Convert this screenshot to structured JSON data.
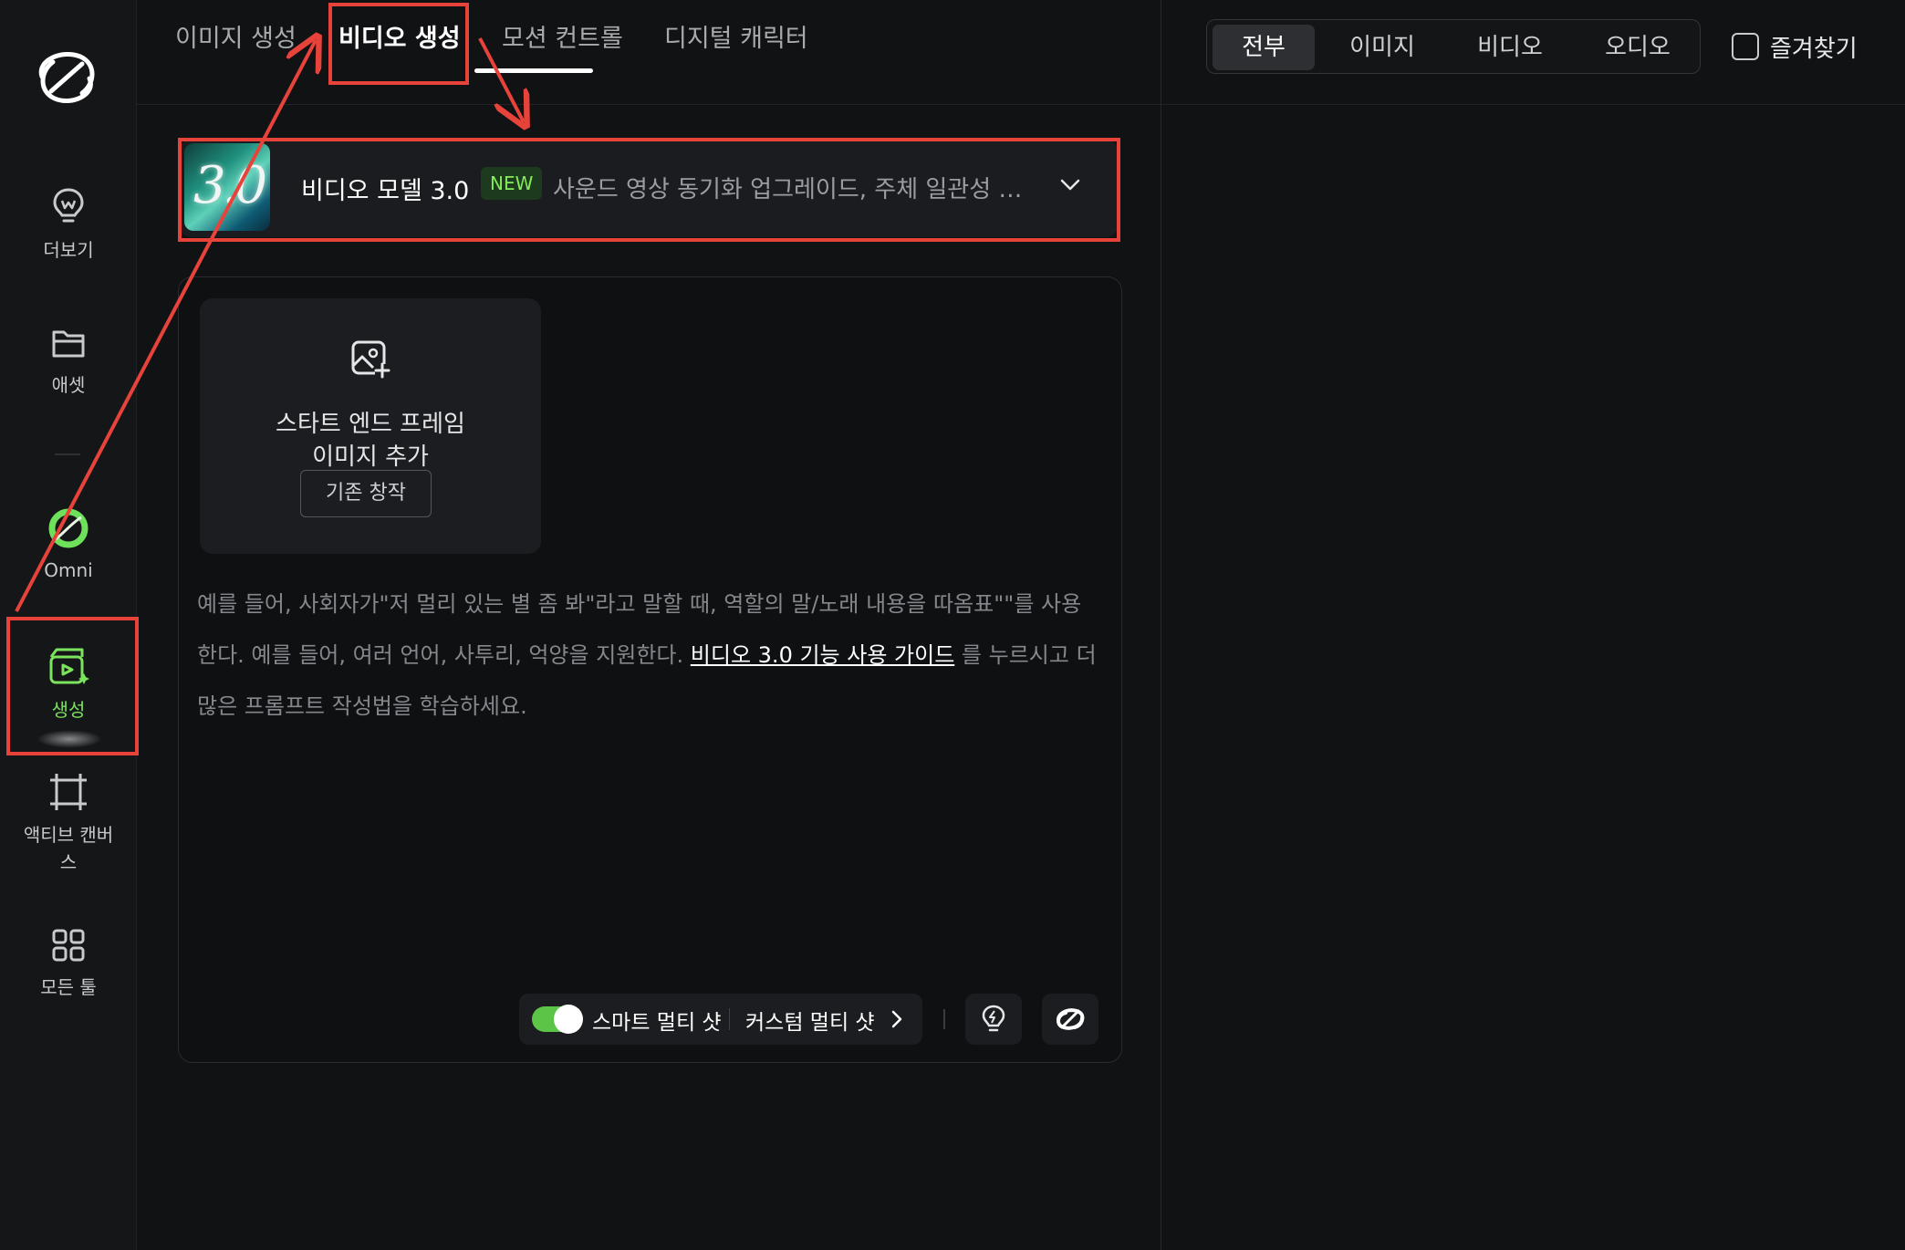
{
  "sidebar": {
    "items": [
      {
        "label": "더보기",
        "icon": "lightbulb-icon"
      },
      {
        "label": "애셋",
        "icon": "folder-icon"
      },
      {
        "label": "Omni",
        "icon": "omni-ring-icon"
      },
      {
        "label": "생성",
        "icon": "generate-icon"
      },
      {
        "label": "액티브 캔버스",
        "icon": "canvas-frame-icon"
      },
      {
        "label": "모든 툴",
        "icon": "grid-icon"
      }
    ],
    "active_color": "#7be35d"
  },
  "tabs": [
    {
      "label": "이미지 생성"
    },
    {
      "label": "비디오 생성"
    },
    {
      "label": "모션 컨트롤"
    },
    {
      "label": "디지털 캐릭터"
    }
  ],
  "filter": {
    "segments": [
      "전부",
      "이미지",
      "비디오",
      "오디오"
    ],
    "favorites_label": "즐겨찾기"
  },
  "model": {
    "thumb_text": "3.0",
    "name": "비디오 모델 3.0",
    "badge": "NEW",
    "description": "사운드 영상 동기화 업그레이드, 주체 일관성 …"
  },
  "upload": {
    "title_line1": "스타트 엔드 프레임",
    "title_line2": "이미지 추가",
    "legacy_button": "기존 창작"
  },
  "prompt": {
    "text_before": "예를 들어, 사회자가\"저 멀리 있는 별 좀 봐\"라고 말할 때, 역할의 말/노래 내용을 따옴표\"\"를 사용한다. 예를 들어, 여러 언어, 사투리, 억양을 지원한다.",
    "link": "비디오 3.0 기능 사용 가이드",
    "text_after": "를 누르시고 더 많은 프롬프트 작성법을 학습하세요."
  },
  "toolbar": {
    "smart_multishot": "스마트 멀티 샷",
    "custom_multishot": "커스텀 멀티 샷",
    "smart_multishot_enabled": true,
    "toggle_color": "#5cc447"
  },
  "annotation_color": "#e8433a"
}
